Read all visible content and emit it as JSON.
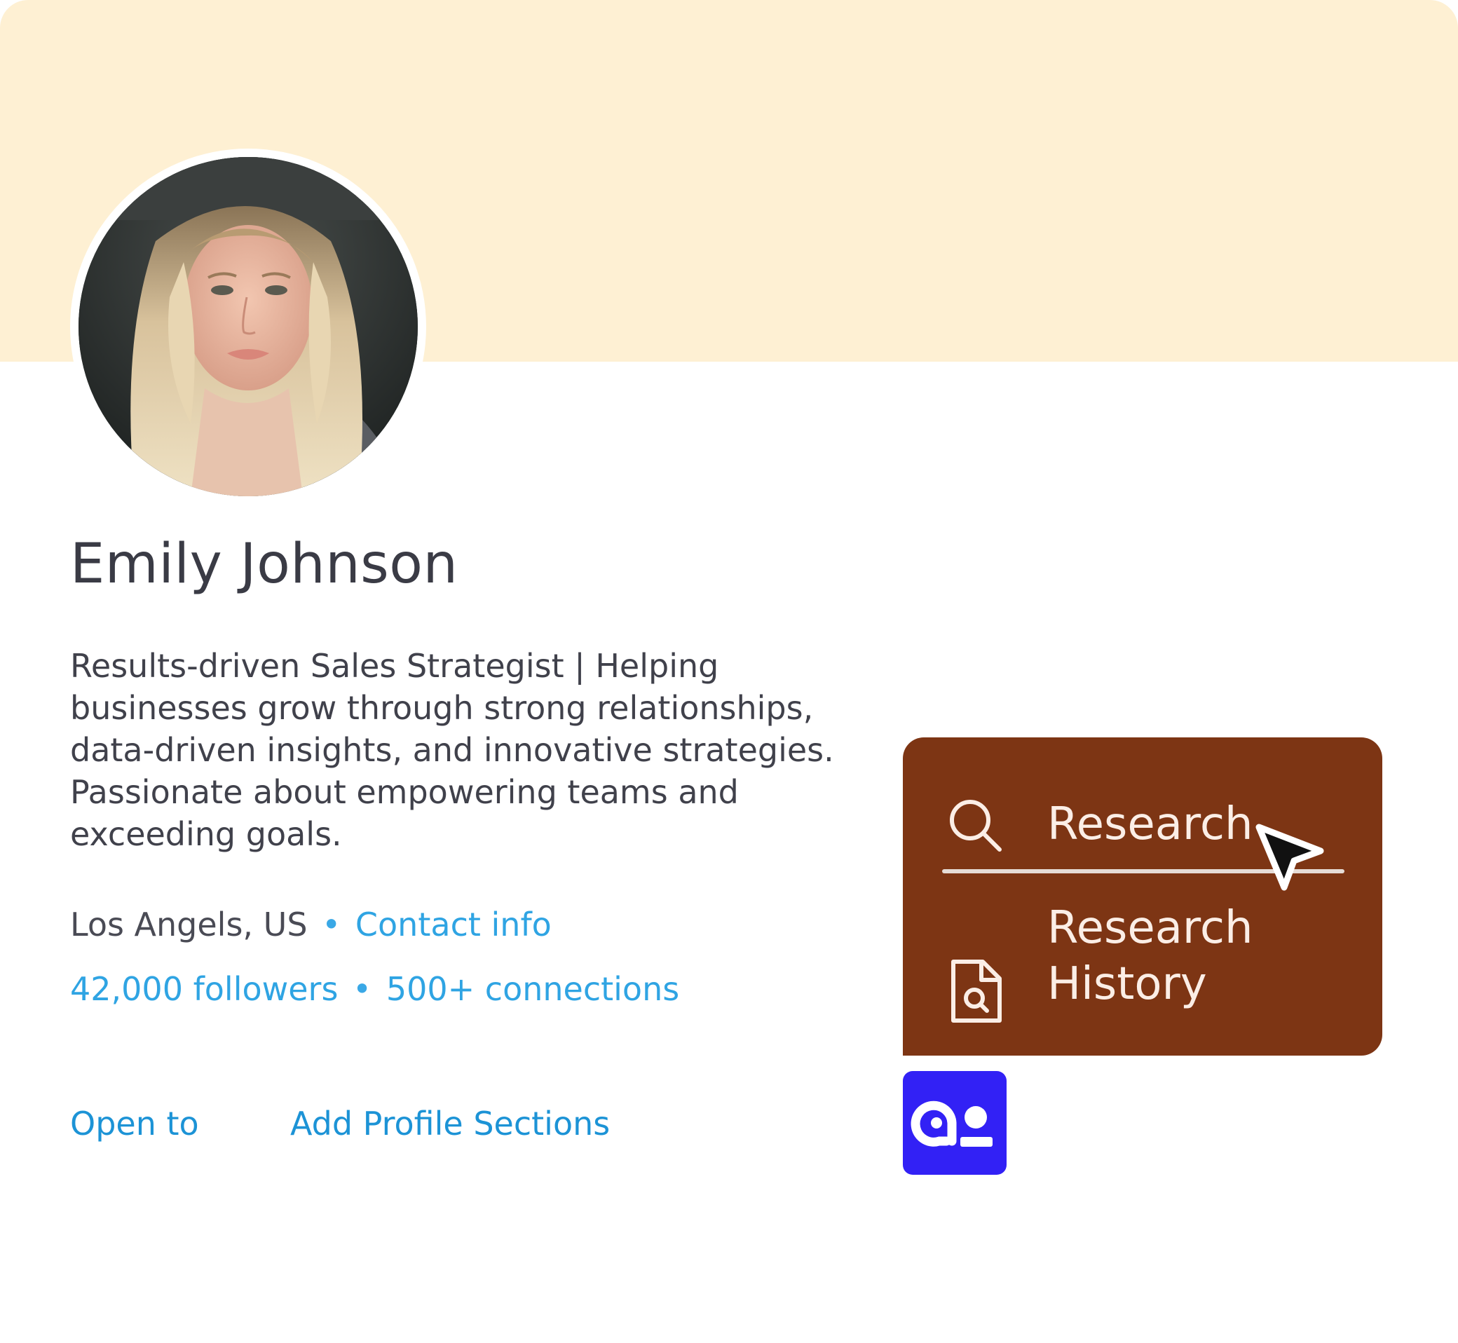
{
  "profile": {
    "name": "Emily Johnson",
    "headline": "Results-driven Sales Strategist | Helping businesses grow through strong relationships, data-driven insights, and innovative strategies. Passionate about empowering teams and exceeding goals.",
    "location": "Los Angels, US",
    "separator": "•",
    "contact_info_label": "Contact info",
    "followers": "42,000 followers",
    "connections": "500+ connections",
    "stats_separator": "•"
  },
  "actions": {
    "open_to": "Open to",
    "add_profile_sections": "Add Profile Sections"
  },
  "popup_menu": {
    "items": [
      {
        "label": "Research",
        "icon": "search-icon"
      },
      {
        "label": "Research History",
        "icon": "document-search-icon"
      }
    ]
  },
  "colors": {
    "banner": "#fef0d3",
    "menu_background": "#7d3514",
    "link": "#2fa4e3",
    "app_logo_background": "#3221f5"
  },
  "icons": {
    "cursor": "cursor-arrow-icon",
    "app_logo": "app-logo-icon"
  }
}
